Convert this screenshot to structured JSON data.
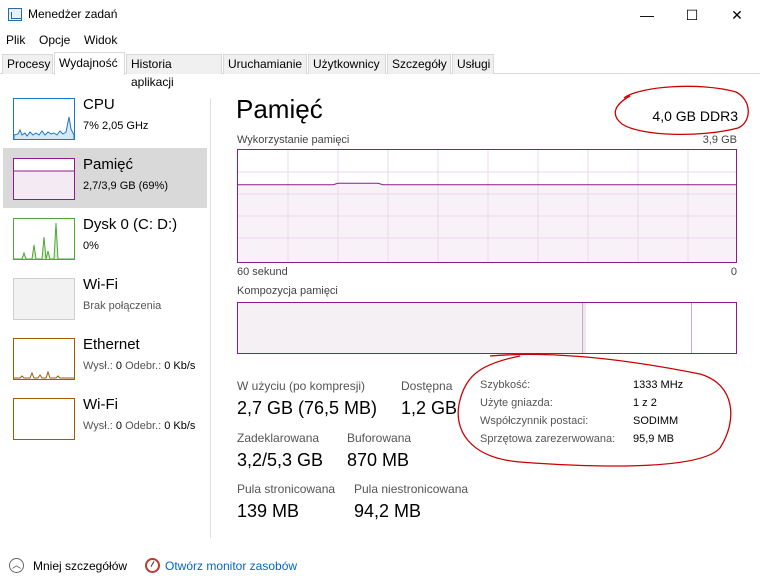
{
  "window": {
    "title": "Menedżer zadań",
    "minimize_glyph": "—",
    "maximize_glyph": "☐",
    "close_glyph": "✕"
  },
  "menu": [
    "Plik",
    "Opcje",
    "Widok"
  ],
  "tabs": [
    {
      "label": "Procesy"
    },
    {
      "label": "Wydajność",
      "active": true
    },
    {
      "label": "Historia aplikacji"
    },
    {
      "label": "Uruchamianie"
    },
    {
      "label": "Użytkownicy"
    },
    {
      "label": "Szczegóły"
    },
    {
      "label": "Usługi"
    }
  ],
  "sidebar": {
    "items": [
      {
        "name": "CPU",
        "sub": "7% 2,05 GHz",
        "color": "#1a78c8"
      },
      {
        "name": "Pamięć",
        "sub": "2,7/3,9 GB (69%)",
        "color": "#8b1a8b"
      },
      {
        "name": "Dysk 0 (C: D:)",
        "sub": "0%",
        "color": "#4da833"
      },
      {
        "name": "Wi-Fi",
        "sub": "Brak połączenia",
        "color": "#aaaaaa"
      },
      {
        "name": "Ethernet",
        "sub_label1": "Wysł.:",
        "sub_val1": "0",
        "sub_label2": "Odebr.:",
        "sub_val2": "0 Kb/s",
        "color": "#a05a00"
      },
      {
        "name": "Wi-Fi",
        "sub_label1": "Wysł.:",
        "sub_val1": "0",
        "sub_label2": "Odebr.:",
        "sub_val2": "0 Kb/s",
        "color": "#a05a00"
      }
    ]
  },
  "main": {
    "title": "Pamięć",
    "spec": "4,0 GB DDR3",
    "usage_label": "Wykorzystanie pamięci",
    "usage_max": "3,9 GB",
    "time_label": "60 sekund",
    "time_min": "0",
    "composition_label": "Kompozycja pamięci",
    "usage_fraction": 0.69,
    "graph_color": "#8b1a8b"
  },
  "stats": {
    "in_use_label": "W użyciu (po kompresji)",
    "in_use_value": "2,7 GB (76,5 MB)",
    "available_label": "Dostępna",
    "available_value": "1,2 GB",
    "committed_label": "Zadeklarowana",
    "committed_value": "3,2/5,3 GB",
    "cached_label": "Buforowana",
    "cached_value": "870 MB",
    "paged_label": "Pula stronicowana",
    "paged_value": "139 MB",
    "nonpaged_label": "Pula niestronicowana",
    "nonpaged_value": "94,2 MB"
  },
  "details": [
    {
      "label": "Szybkość:",
      "value": "1333 MHz"
    },
    {
      "label": "Użyte gniazda:",
      "value": "1 z 2"
    },
    {
      "label": "Współczynnik postaci:",
      "value": "SODIMM"
    },
    {
      "label": "Sprzętowa zarezerwowana:",
      "value": "95,9 MB"
    }
  ],
  "footer": {
    "fewer_details": "Mniej szczegółów",
    "resource_monitor": "Otwórz monitor zasobów"
  },
  "annotation_color": "#cc0000"
}
